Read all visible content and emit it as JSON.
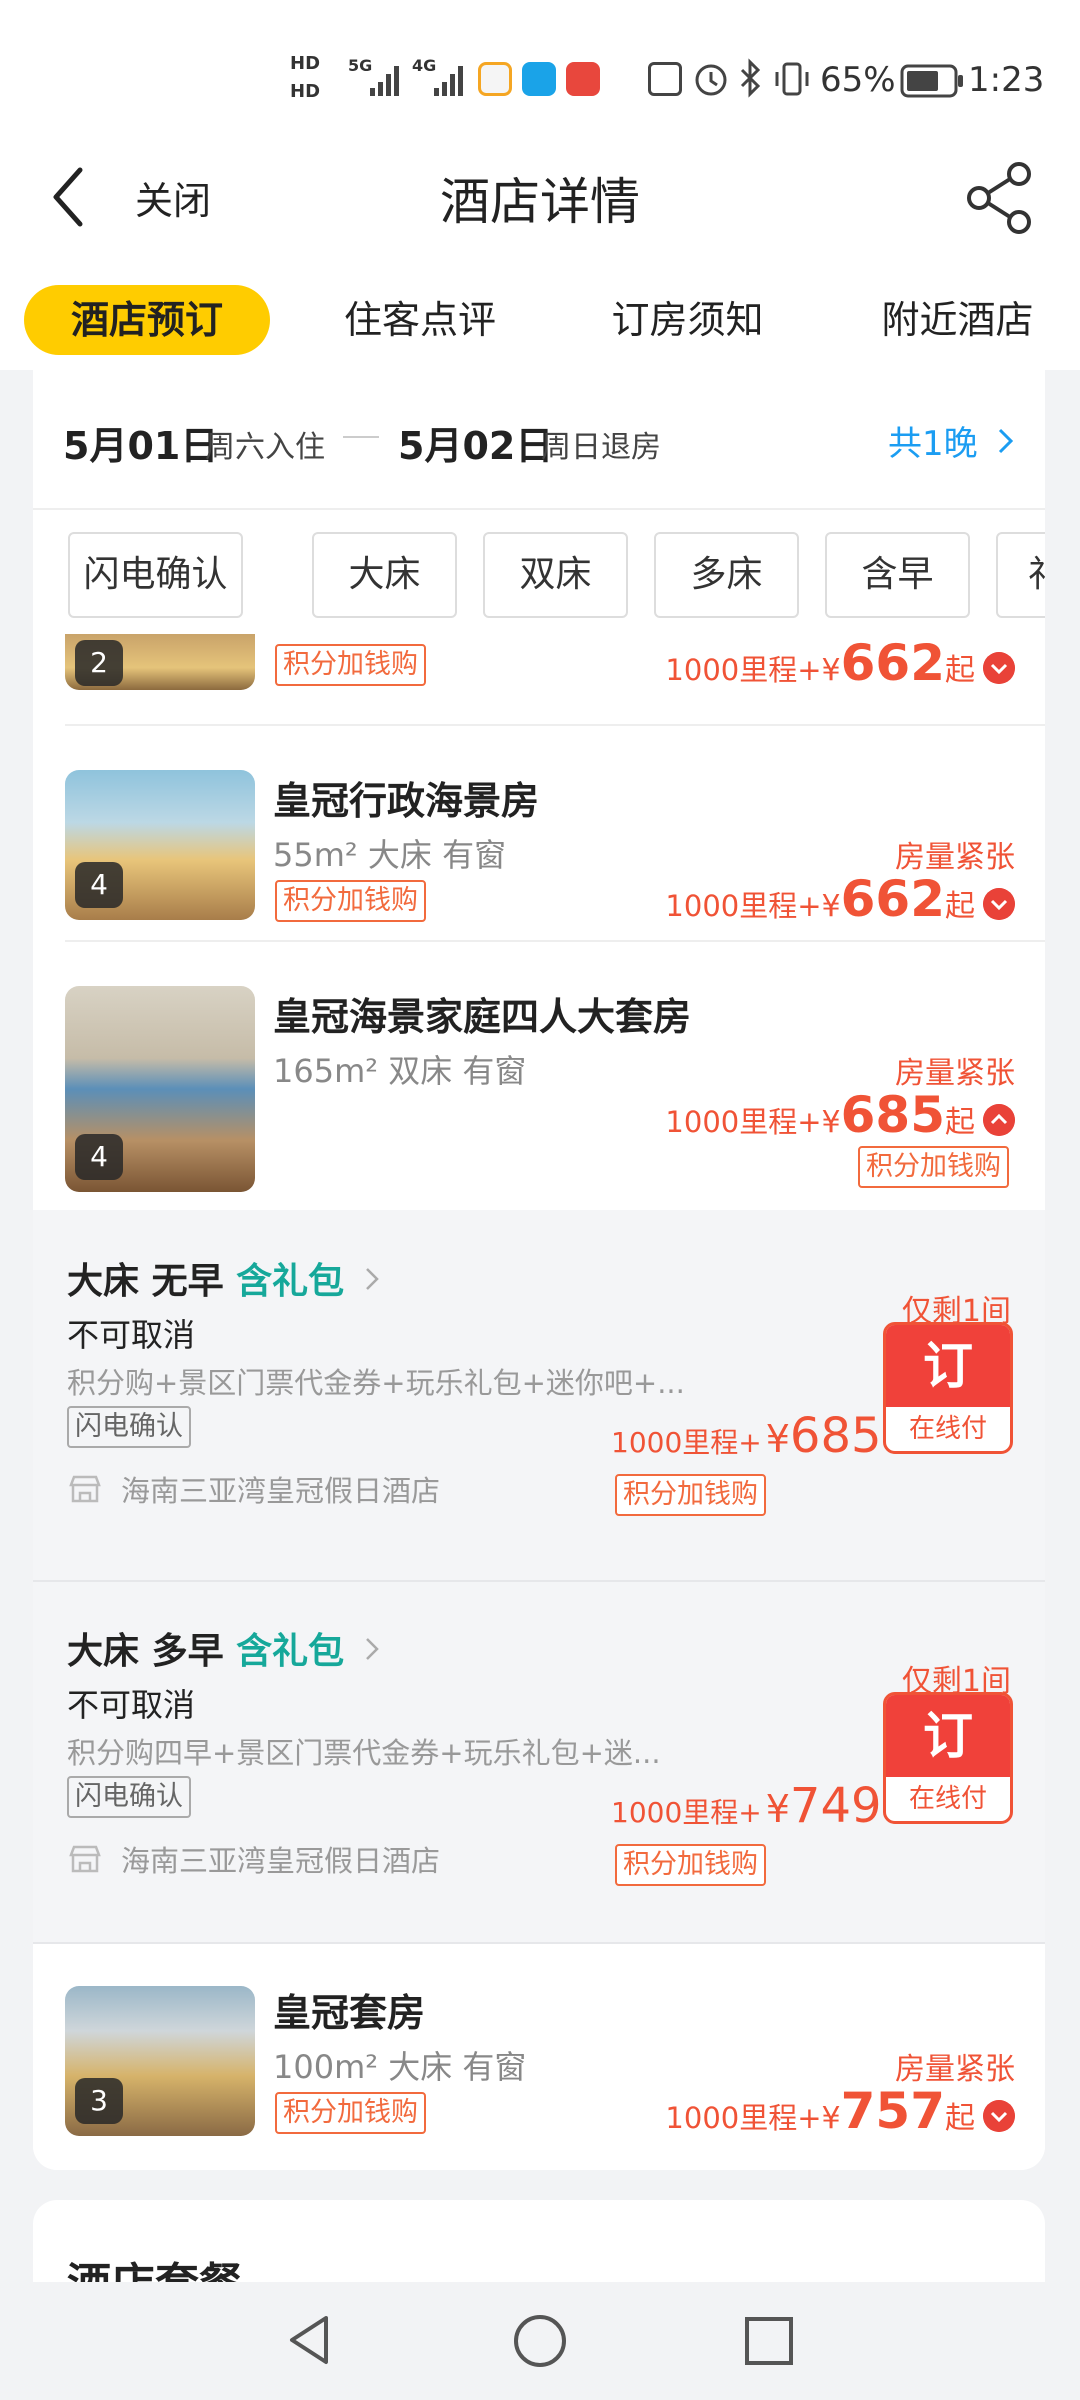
{
  "status_bar": {
    "battery": "65%",
    "time": "1:23",
    "sim1": "HD",
    "sim2": "HD",
    "net1": "5G",
    "net2": "4G"
  },
  "header": {
    "close_label": "关闭",
    "title": "酒店详情",
    "tabs": [
      "酒店预订",
      "住客点评",
      "订房须知",
      "附近酒店"
    ]
  },
  "dates": {
    "checkin_date": "5月01日",
    "checkin_label": "周六入住",
    "checkout_date": "5月02日",
    "checkout_label": "周日退房",
    "nights": "共1晚"
  },
  "filters": [
    "闪电确认",
    "大床",
    "双床",
    "多床",
    "含早",
    "礼"
  ],
  "rooms": [
    {
      "badge": "2",
      "tag": "积分加钱购",
      "mileage": "1000里程+",
      "currency": "¥",
      "price": "662",
      "suffix": "起"
    },
    {
      "name": "皇冠行政海景房",
      "specs": "55m² 大床 有窗",
      "badge": "4",
      "tag": "积分加钱购",
      "availability": "房量紧张",
      "mileage": "1000里程+",
      "currency": "¥",
      "price": "662",
      "suffix": "起"
    },
    {
      "name": "皇冠海景家庭四人大套房",
      "specs": "165m² 双床 有窗",
      "badge": "4",
      "tag": "积分加钱购",
      "availability": "房量紧张",
      "mileage": "1000里程+",
      "currency": "¥",
      "price": "685",
      "suffix": "起"
    },
    {
      "name": "皇冠套房",
      "specs": "100m² 大床 有窗",
      "badge": "3",
      "tag": "积分加钱购",
      "availability": "房量紧张",
      "mileage": "1000里程+",
      "currency": "¥",
      "price": "757",
      "suffix": "起"
    }
  ],
  "plans": [
    {
      "bed": "大床",
      "meal": "无早",
      "gift": "含礼包",
      "cancel": "不可取消",
      "desc": "积分购+景区门票代金券+玩乐礼包+迷你吧+...",
      "confirm_tag": "闪电确认",
      "hotel": "海南三亚湾皇冠假日酒店",
      "remain": "仅剩1间",
      "mileage": "1000里程+",
      "currency": "¥",
      "price": "685",
      "tag": "积分加钱购",
      "book_label": "订",
      "pay_label": "在线付"
    },
    {
      "bed": "大床",
      "meal": "多早",
      "gift": "含礼包",
      "cancel": "不可取消",
      "desc": "积分购四早+景区门票代金券+玩乐礼包+迷...",
      "confirm_tag": "闪电确认",
      "hotel": "海南三亚湾皇冠假日酒店",
      "remain": "仅剩1间",
      "mileage": "1000里程+",
      "currency": "¥",
      "price": "749",
      "tag": "积分加钱购",
      "book_label": "订",
      "pay_label": "在线付"
    }
  ],
  "package_title": "酒店套餐",
  "colors": {
    "accent_yellow": "#ffcc00",
    "price_red": "#f05336",
    "gift_green": "#16a89a",
    "link_blue": "#1b9df2"
  }
}
